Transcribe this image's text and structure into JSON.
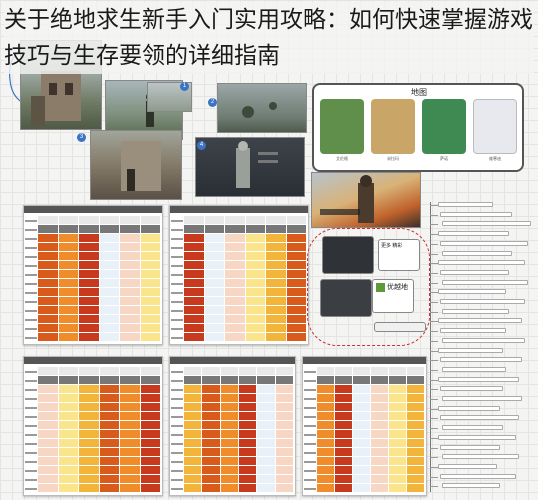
{
  "headline": "关于绝地求生新手入门实用攻略：如何快速掌握游戏技巧与生存要领的详细指南",
  "map_panel": {
    "title": "地图",
    "maps": [
      {
        "name": "艾伦格",
        "color": "#5f8f4a"
      },
      {
        "name": "米拉玛",
        "color": "#c9a668"
      },
      {
        "name": "萨诺",
        "color": "#3f8a52"
      },
      {
        "name": "维寒迪",
        "color": "#e7e9ee"
      }
    ]
  },
  "steps": [
    "1",
    "2",
    "3",
    "4",
    "5",
    "6"
  ],
  "tables": [
    {
      "name": "table-1"
    },
    {
      "name": "table-2"
    },
    {
      "name": "table-3"
    },
    {
      "name": "table-4"
    },
    {
      "name": "table-5"
    }
  ],
  "cards": {
    "card_a": "更多 精彩",
    "card_b": "优越地"
  },
  "colors": {
    "accent_blue": "#3a73c4",
    "red_dash": "#d03030",
    "table_header": "#555555",
    "heat_high": "#d95b1c",
    "heat_mid": "#f3b43a",
    "heat_low": "#fbe58c"
  }
}
